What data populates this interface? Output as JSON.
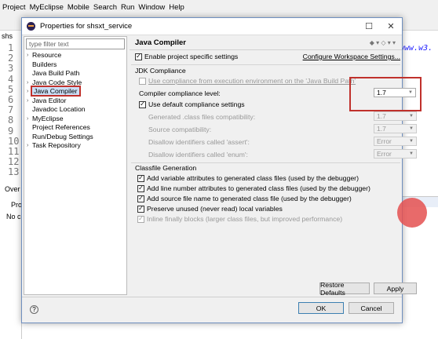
{
  "eclipse": {
    "menu": [
      "Project",
      "MyEclipse",
      "Mobile",
      "Search",
      "Run",
      "Window",
      "Help"
    ],
    "line_numbers": [
      "1",
      "2",
      "3",
      "4",
      "5",
      "6",
      "7",
      "8",
      "9",
      "10",
      "11",
      "12",
      "13"
    ],
    "left_tab": "shs",
    "url_text": "www.w3.",
    "bottom_tab_over": "Over",
    "bottom_tab_pro": "Pro",
    "bottom_text": "No c"
  },
  "dialog": {
    "title": "Properties for shsxt_service",
    "filter_placeholder": "type filter text",
    "nav": [
      {
        "label": "Resource",
        "arrow": true
      },
      {
        "label": "Builders",
        "arrow": false
      },
      {
        "label": "Java Build Path",
        "arrow": false
      },
      {
        "label": "Java Code Style",
        "arrow": true
      },
      {
        "label": "Java Compiler",
        "arrow": true,
        "selected": true
      },
      {
        "label": "Java Editor",
        "arrow": true
      },
      {
        "label": "Javadoc Location",
        "arrow": false
      },
      {
        "label": "MyEclipse",
        "arrow": true
      },
      {
        "label": "Project References",
        "arrow": false
      },
      {
        "label": "Run/Debug Settings",
        "arrow": false
      },
      {
        "label": "Task Repository",
        "arrow": true
      }
    ],
    "page": {
      "heading": "Java Compiler",
      "enable_specific": "Enable project specific settings",
      "configure_link": "Configure Workspace Settings...",
      "jdk_group": "JDK Compliance",
      "use_compliance": "Use compliance from execution environment on the 'Java Build Path'",
      "compliance_label": "Compiler compliance level:",
      "compliance_value": "1.7",
      "use_default": "Use default compliance settings",
      "gen_class_label": "Generated .class files compatibility:",
      "gen_class_value": "1.7",
      "source_label": "Source compatibility:",
      "source_value": "1.7",
      "assert_label": "Disallow identifiers called 'assert':",
      "assert_value": "Error",
      "enum_label": "Disallow identifiers called 'enum':",
      "enum_value": "Error",
      "classfile_group": "Classfile Generation",
      "classfile_options": [
        {
          "label": "Add variable attributes to generated class files (used by the debugger)",
          "checked": true,
          "disabled": false
        },
        {
          "label": "Add line number attributes to generated class files (used by the debugger)",
          "checked": true,
          "disabled": false
        },
        {
          "label": "Add source file name to generated class file (used by the debugger)",
          "checked": true,
          "disabled": false
        },
        {
          "label": "Preserve unused (never read) local variables",
          "checked": true,
          "disabled": false
        },
        {
          "label": "Inline finally blocks (larger class files, but improved performance)",
          "checked": true,
          "disabled": true
        }
      ]
    },
    "buttons": {
      "restore": "Restore Defaults",
      "apply": "Apply",
      "ok": "OK",
      "cancel": "Cancel",
      "help": "?"
    }
  },
  "colors": {
    "highlight_red": "#c0312c",
    "selection_blue": "#cde0f7",
    "cursor_dot": "#e45050"
  }
}
